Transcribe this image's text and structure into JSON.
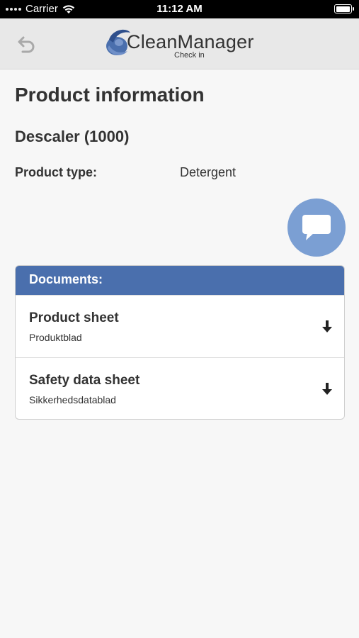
{
  "status_bar": {
    "carrier": "Carrier",
    "time": "11:12 AM",
    "battery_level": 1.0
  },
  "header": {
    "logo_text": "CleanManager",
    "logo_subtitle": "Check in",
    "back_icon": "undo-arrow-icon"
  },
  "page": {
    "title": "Product information",
    "product_name": "Descaler (1000)",
    "product_type_label": "Product type:",
    "product_type_value": "Detergent"
  },
  "chat_button": {
    "icon": "chat-bubble-icon",
    "color": "#7b9fd3"
  },
  "documents": {
    "header": "Documents:",
    "header_color": "#4a6fad",
    "items": [
      {
        "title": "Product sheet",
        "subtitle": "Produktblad",
        "icon": "download-arrow-icon"
      },
      {
        "title": "Safety data sheet",
        "subtitle": "Sikkerhedsdatablad",
        "icon": "download-arrow-icon"
      }
    ]
  }
}
